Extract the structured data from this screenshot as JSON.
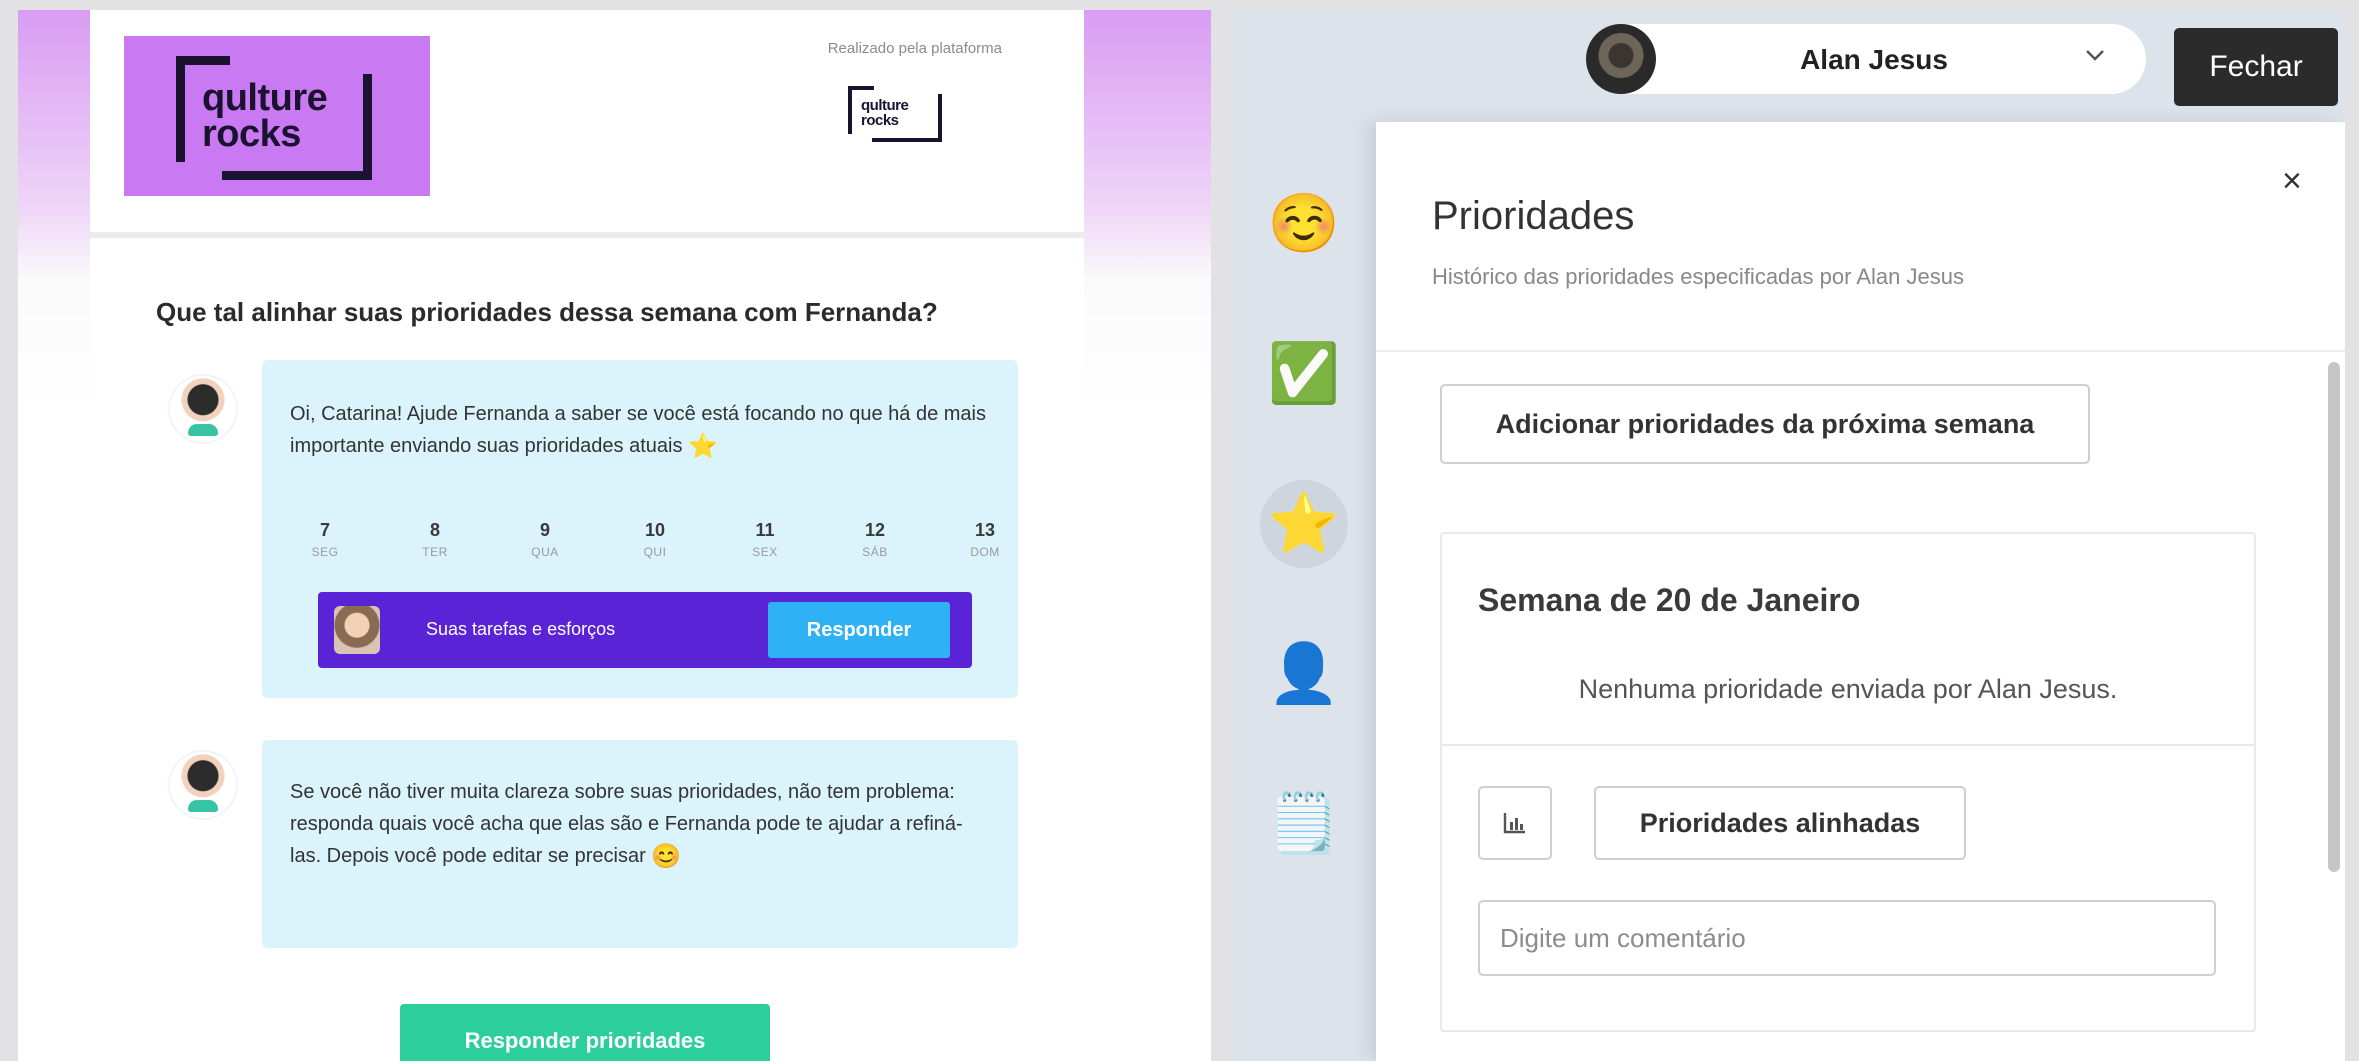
{
  "email": {
    "logo_line1": "qulture",
    "logo_line2": "rocks",
    "platform_caption": "Realizado pela plataforma",
    "question": "Que tal alinhar suas prioridades dessa semana com Fernanda?",
    "message1": "Oi, Catarina! Ajude Fernanda a saber se você está focando no que há de mais importante enviando suas prioridades atuais",
    "message1_emoji": "⭐",
    "days": [
      {
        "num": "7",
        "label": "SEG"
      },
      {
        "num": "8",
        "label": "TER"
      },
      {
        "num": "9",
        "label": "QUA"
      },
      {
        "num": "10",
        "label": "QUI"
      },
      {
        "num": "11",
        "label": "SEX"
      },
      {
        "num": "12",
        "label": "SÁB"
      },
      {
        "num": "13",
        "label": "DOM"
      }
    ],
    "task_label": "Suas tarefas e esforços",
    "task_button": "Responder",
    "message2": "Se você não tiver muita clareza sobre suas prioridades, não tem problema: responda quais você acha que elas são e Fernanda pode te ajudar a refiná-las. Depois você pode editar se precisar",
    "message2_emoji": "😊",
    "respond_button": "Responder prioridades"
  },
  "app": {
    "user_name": "Alan Jesus",
    "close_button": "Fechar",
    "rail_icons": [
      "smiling-face-icon",
      "check-mark-button-icon",
      "star-icon",
      "user-silhouette-icon",
      "notepad-icon"
    ],
    "drawer": {
      "title": "Prioridades",
      "subtitle": "Histórico das prioridades especificadas por Alan Jesus",
      "close_symbol": "×",
      "add_button": "Adicionar prioridades da próxima semana",
      "week_title": "Semana de 20 de Janeiro",
      "empty_message": "Nenhuma prioridade enviada por Alan Jesus.",
      "aligned_button": "Prioridades alinhadas",
      "comment_placeholder": "Digite um comentário"
    }
  },
  "colors": {
    "brand_purple": "#c97af2",
    "task_bar": "#5b23d6",
    "respond_blue": "#2fb2f5",
    "respond_green": "#2ccf9a",
    "bubble_bg": "#dbf3fb"
  }
}
